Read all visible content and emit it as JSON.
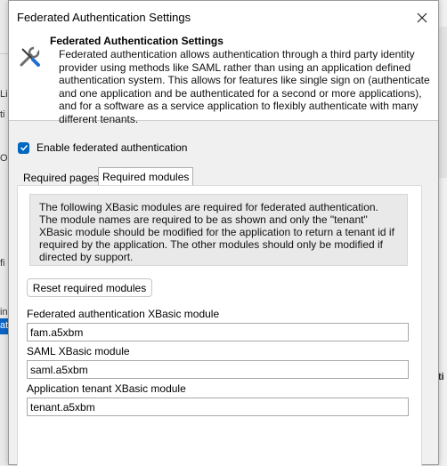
{
  "background": {
    "fragments": [
      "Li",
      "ti",
      "Op",
      "fi",
      "in",
      "at"
    ],
    "right_fragment": "ti"
  },
  "dialog": {
    "window_title": "Federated Authentication Settings",
    "header_title": "Federated Authentication Settings",
    "header_description": "Federated authentication allows authentication through a third party identity provider using methods like SAML rather than using an application defined authentication system. This allows for features like single sign on (authenticate and one application and be authenticated for a second or more applications), and for a software as a service application to flexibly authenticate with many different tenants.",
    "enable_checkbox": {
      "label": "Enable federated authentication",
      "checked": true
    },
    "tabs": [
      {
        "label": "Required pages",
        "active": false
      },
      {
        "label": "Required modules",
        "active": true
      }
    ],
    "info_text": "The following XBasic modules are required for federated authentication. The module names are required to be as shown and only the \"tenant\" XBasic module should be modified for the application to return a tenant id if required by the application. The other modules should only be modified if directed by support.",
    "reset_button": "Reset required modules",
    "fields": [
      {
        "label": "Federated authentication XBasic module",
        "value": "fam.a5xbm"
      },
      {
        "label": "SAML XBasic module",
        "value": "saml.a5xbm"
      },
      {
        "label": "Application tenant XBasic module",
        "value": "tenant.a5xbm"
      }
    ],
    "accent_color": "#0067c0"
  }
}
